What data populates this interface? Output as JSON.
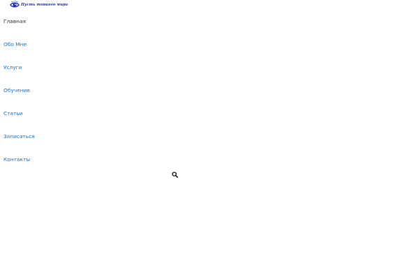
{
  "header": {
    "logo_text": "Пусть тонкого мира",
    "logo_icon": "eye-icon",
    "brand_color": "#1f2db5"
  },
  "nav": {
    "items": [
      {
        "label": "Главная",
        "active": true
      },
      {
        "label": "Обо Мне",
        "active": false
      },
      {
        "label": "Услуги",
        "active": false
      },
      {
        "label": "Обучение",
        "active": false
      },
      {
        "label": "Статьи",
        "active": false
      },
      {
        "label": "Записаться",
        "active": false
      },
      {
        "label": "Контакты",
        "active": false
      }
    ],
    "link_color": "#1e73be",
    "active_color": "#3a3a3a"
  },
  "search": {
    "icon": "search-icon"
  }
}
